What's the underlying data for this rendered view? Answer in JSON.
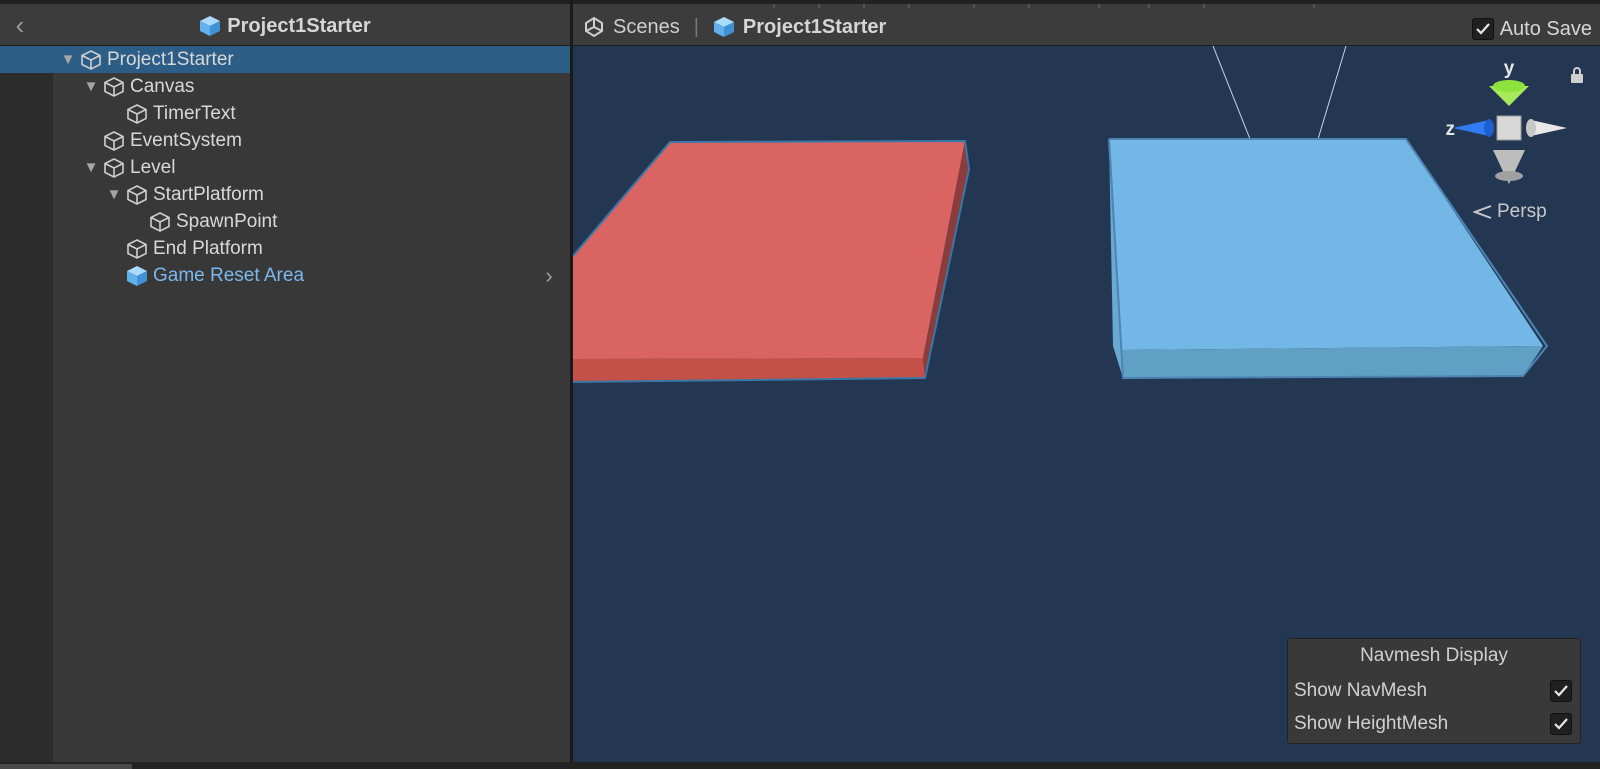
{
  "hierarchy": {
    "title": "Project1Starter",
    "items": [
      {
        "label": "Project1Starter",
        "depth": 0,
        "expanded": true,
        "selected": true,
        "prefab": false
      },
      {
        "label": "Canvas",
        "depth": 1,
        "expanded": true,
        "selected": false,
        "prefab": false
      },
      {
        "label": "TimerText",
        "depth": 2,
        "expanded": null,
        "selected": false,
        "prefab": false
      },
      {
        "label": "EventSystem",
        "depth": 1,
        "expanded": null,
        "selected": false,
        "prefab": false
      },
      {
        "label": "Level",
        "depth": 1,
        "expanded": true,
        "selected": false,
        "prefab": false
      },
      {
        "label": "StartPlatform",
        "depth": 2,
        "expanded": true,
        "selected": false,
        "prefab": false
      },
      {
        "label": "SpawnPoint",
        "depth": 3,
        "expanded": null,
        "selected": false,
        "prefab": false
      },
      {
        "label": "End Platform",
        "depth": 2,
        "expanded": null,
        "selected": false,
        "prefab": false
      },
      {
        "label": "Game Reset Area",
        "depth": 2,
        "expanded": null,
        "selected": false,
        "prefab": true
      }
    ]
  },
  "scene": {
    "breadcrumb_scenes": "Scenes",
    "breadcrumb_project": "Project1Starter",
    "auto_save_label": "Auto Save",
    "auto_save_checked": true,
    "gizmo": {
      "y_label": "y",
      "z_label": "z"
    },
    "projection_label": "Persp",
    "navmesh": {
      "title": "Navmesh Display",
      "options": [
        {
          "label": "Show NavMesh",
          "checked": true
        },
        {
          "label": "Show HeightMesh",
          "checked": true
        }
      ]
    }
  },
  "colors": {
    "prefab_blue": "#7cb7ee",
    "selection": "#2c5d87",
    "scene_background": "#233753",
    "start_platform": "#d95f5d",
    "end_platform": "#72b6e5",
    "gizmo_y": "#8ee23c",
    "gizmo_z": "#2f7df2"
  }
}
